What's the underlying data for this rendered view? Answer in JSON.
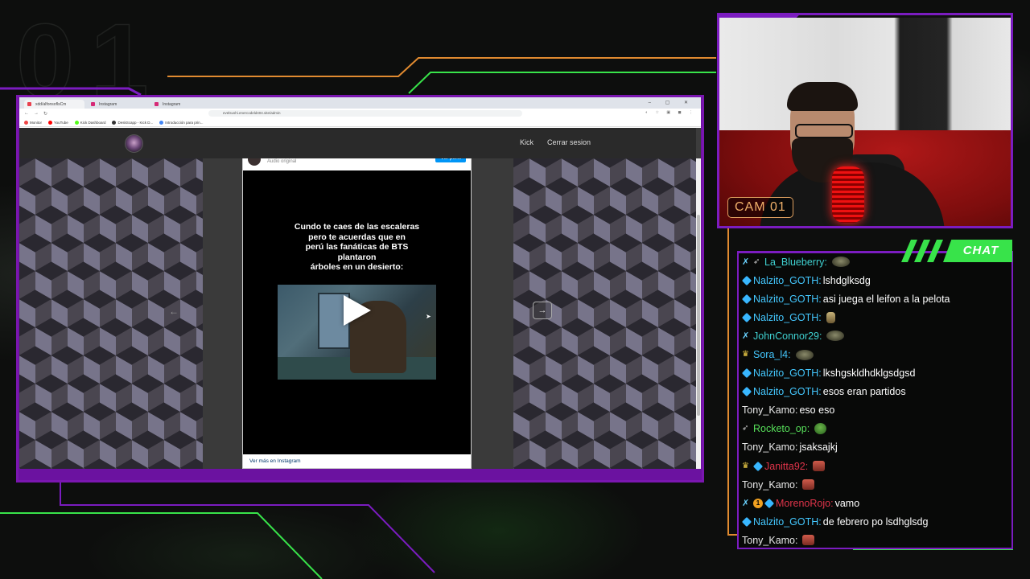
{
  "overlay": {
    "big_number": "01",
    "cam_label": "CAM 01",
    "chat_label": "CHAT"
  },
  "browser": {
    "tabs": [
      {
        "label": "xdd/alfonsoflsCm",
        "color": "#e9414f",
        "active": true
      },
      {
        "label": "Instagram",
        "color": "#d62976",
        "active": false
      },
      {
        "label": "Instagram",
        "color": "#d62976",
        "active": false
      }
    ],
    "window_controls": "–  ▢  ✕",
    "url": "evelsushi.enercodeld404.site/admin",
    "bookmarks": [
      {
        "label": "Monitor",
        "color": "#e44"
      },
      {
        "label": "YouTube",
        "color": "#f00"
      },
      {
        "label": "Kick Dashboard",
        "color": "#53fc18"
      },
      {
        "label": "DeskScapp - Kick D...",
        "color": "#333"
      },
      {
        "label": "Introducción para prin...",
        "color": "#4285f4"
      }
    ]
  },
  "site": {
    "nav": [
      "Kick",
      "Cerrar sesion"
    ]
  },
  "instagram": {
    "audio_label": "Audio original",
    "profile_button": "Ver perfil",
    "meme_text": "Cundo te caes de las escaleras\npero te acuerdas que en\nperú las fanáticas de BTS\nplantaron\nárboles en un desierto:",
    "more_link": "Ver más en Instagram"
  },
  "chat": {
    "messages": [
      {
        "badges": [
          "sword",
          "rocket"
        ],
        "user": "La_Blueberry",
        "user_color": "#3fd0d0",
        "text": "",
        "emote": "emote"
      },
      {
        "badges": [
          "cube"
        ],
        "user": "Nalzito_GOTH",
        "user_color": "#44c8ff",
        "text": "lshdglksdg",
        "emote": ""
      },
      {
        "badges": [
          "cube"
        ],
        "user": "Nalzito_GOTH",
        "user_color": "#44c8ff",
        "text": "asi juega el leifon a la pelota",
        "emote": ""
      },
      {
        "badges": [
          "cube"
        ],
        "user": "Nalzito_GOTH",
        "user_color": "#44c8ff",
        "text": "",
        "emote": "tiny"
      },
      {
        "badges": [
          "sword"
        ],
        "user": "JohnConnor29",
        "user_color": "#3fd0d0",
        "text": "",
        "emote": "emote"
      },
      {
        "badges": [
          "crown"
        ],
        "user": "Sora_l4",
        "user_color": "#44c8ff",
        "text": "",
        "emote": "emote"
      },
      {
        "badges": [
          "cube"
        ],
        "user": "Nalzito_GOTH",
        "user_color": "#44c8ff",
        "text": "lkshgskldhdklgsdgsd",
        "emote": ""
      },
      {
        "badges": [
          "cube"
        ],
        "user": "Nalzito_GOTH",
        "user_color": "#44c8ff",
        "text": "esos eran partidos",
        "emote": ""
      },
      {
        "badges": [],
        "user": "Tony_Kamo",
        "user_color": "#e8e8e8",
        "text": "eso eso",
        "emote": ""
      },
      {
        "badges": [
          "rocket"
        ],
        "user": "Rocketo_op",
        "user_color": "#57e05a",
        "text": "",
        "emote": "pepe"
      },
      {
        "badges": [],
        "user": "Tony_Kamo",
        "user_color": "#e8e8e8",
        "text": "jsaksajkj",
        "emote": ""
      },
      {
        "badges": [
          "crown",
          "cube"
        ],
        "user": "Janitta92",
        "user_color": "#e0344a",
        "text": "",
        "emote": "sq"
      },
      {
        "badges": [],
        "user": "Tony_Kamo",
        "user_color": "#e8e8e8",
        "text": "",
        "emote": "sq"
      },
      {
        "badges": [
          "sword",
          "sub",
          "cube"
        ],
        "user": "MorenoRojo",
        "user_color": "#e0344a",
        "text": "vamo",
        "emote": ""
      },
      {
        "badges": [
          "cube"
        ],
        "user": "Nalzito_GOTH",
        "user_color": "#44c8ff",
        "text": "de febrero po lsdhglsdg",
        "emote": ""
      },
      {
        "badges": [],
        "user": "Tony_Kamo",
        "user_color": "#e8e8e8",
        "text": "",
        "emote": "sq"
      }
    ]
  },
  "colors": {
    "accent_purple": "#7b1cc0",
    "accent_green": "#38e34a",
    "accent_orange": "#e08a30"
  }
}
